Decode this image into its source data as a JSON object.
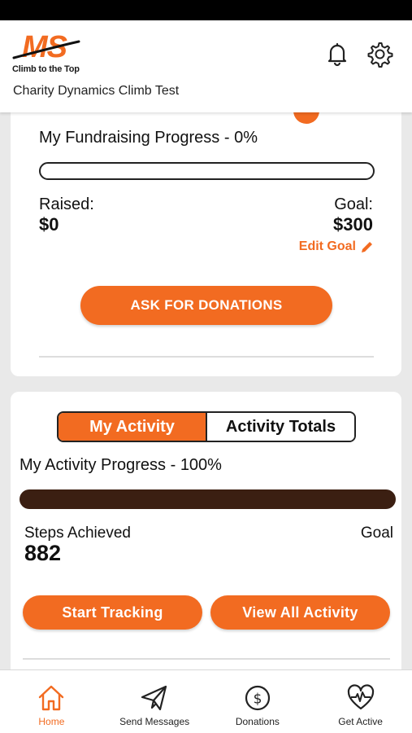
{
  "header": {
    "logo_text": "MS",
    "logo_tagline": "Climb to the Top",
    "subtitle": "Charity Dynamics Climb Test",
    "icons": [
      "bell-icon",
      "gear-icon"
    ]
  },
  "fundraising": {
    "title": "My Fundraising Progress - 0%",
    "progress": 0,
    "raised_label": "Raised:",
    "raised_value": "$0",
    "goal_label": "Goal:",
    "goal_value": "$300",
    "edit_goal_label": "Edit Goal",
    "ask_button": "ASK FOR DONATIONS"
  },
  "activity": {
    "tabs": [
      {
        "label": "My Activity",
        "active": true
      },
      {
        "label": "Activity Totals",
        "active": false
      }
    ],
    "title": "My Activity Progress - 100%",
    "progress": 1.0,
    "steps_label": "Steps Achieved",
    "steps_value": "882",
    "goal_label": "Goal",
    "start_button": "Start Tracking",
    "view_button": "View All Activity"
  },
  "tabbar": {
    "items": [
      {
        "label": "Home",
        "icon": "home-icon",
        "active": true
      },
      {
        "label": "Send Messages",
        "icon": "paper-plane-icon",
        "active": false
      },
      {
        "label": "Donations",
        "icon": "dollar-circle-icon",
        "active": false
      },
      {
        "label": "Get Active",
        "icon": "heartbeat-icon",
        "active": false
      }
    ]
  },
  "colors": {
    "accent": "#f26b21",
    "progress_dark": "#3b1f12",
    "background": "#e9e9e9"
  }
}
